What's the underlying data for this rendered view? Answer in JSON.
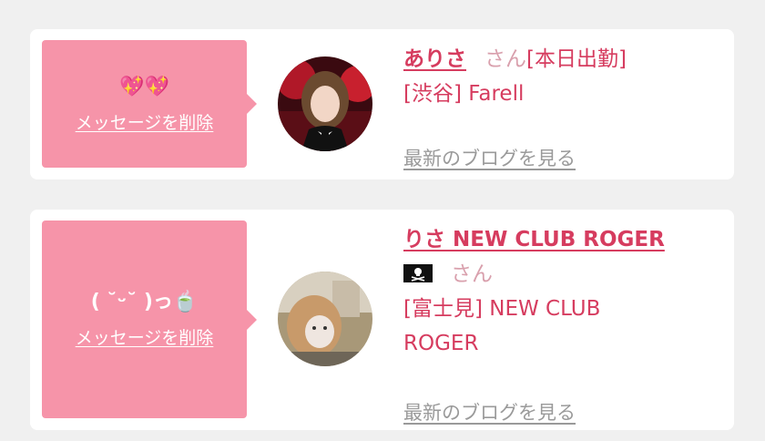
{
  "messages": [
    {
      "message_text": "💖💖",
      "delete_label": "メッセージを削除",
      "avatar_icon": "profile-photo",
      "name": "ありさ",
      "honorific": "さん",
      "status": "[本日出勤]",
      "location": "[渋谷] Farell",
      "blog_link": "最新のブログを見る"
    },
    {
      "message_text": "( ˘ᵕ˘ )っ🍵",
      "delete_label": "メッセージを削除",
      "avatar_icon": "profile-photo",
      "name": "りさ NEW CLUB ROGER",
      "flag_icon": "pirate-flag-icon",
      "honorific": "さん",
      "location_line1": "[富士見] NEW CLUB",
      "location_line2": "ROGER",
      "blog_link": "最新のブログを見る"
    }
  ],
  "colors": {
    "bubble": "#f694a9",
    "accent": "#d63c5f",
    "muted_link": "#9a9a9a",
    "background": "#f0f0f0"
  }
}
